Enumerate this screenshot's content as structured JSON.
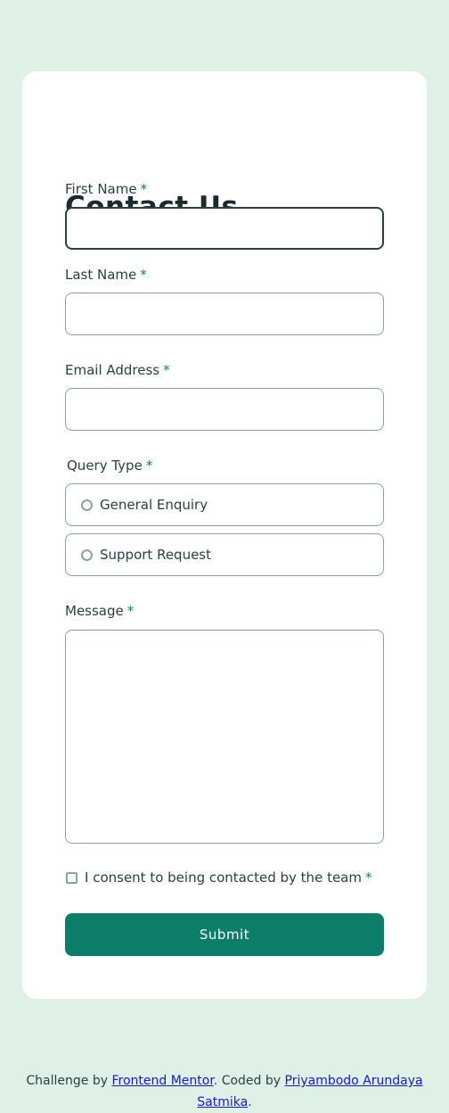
{
  "form": {
    "title": "Contact Us",
    "required_mark": "*",
    "first_name": {
      "label": "First Name",
      "value": ""
    },
    "last_name": {
      "label": "Last Name",
      "value": ""
    },
    "email": {
      "label": "Email Address",
      "value": ""
    },
    "query_type": {
      "label": "Query Type",
      "options": [
        "General Enquiry",
        "Support Request"
      ]
    },
    "message": {
      "label": "Message",
      "value": ""
    },
    "consent": {
      "label": "I consent to being contacted by the team",
      "checked": false
    },
    "submit_label": "Submit"
  },
  "footer": {
    "prefix": "Challenge by ",
    "challenge_link": "Frontend Mentor",
    "middle": ". Coded by ",
    "author_link": "Priyambodo Arundaya Satmika",
    "suffix": "."
  },
  "colors": {
    "background": "#dff1e7",
    "card": "#ffffff",
    "accent": "#0c7d69",
    "border": "#87a3a6",
    "text": "#2a4144",
    "link": "#1a16d8"
  }
}
